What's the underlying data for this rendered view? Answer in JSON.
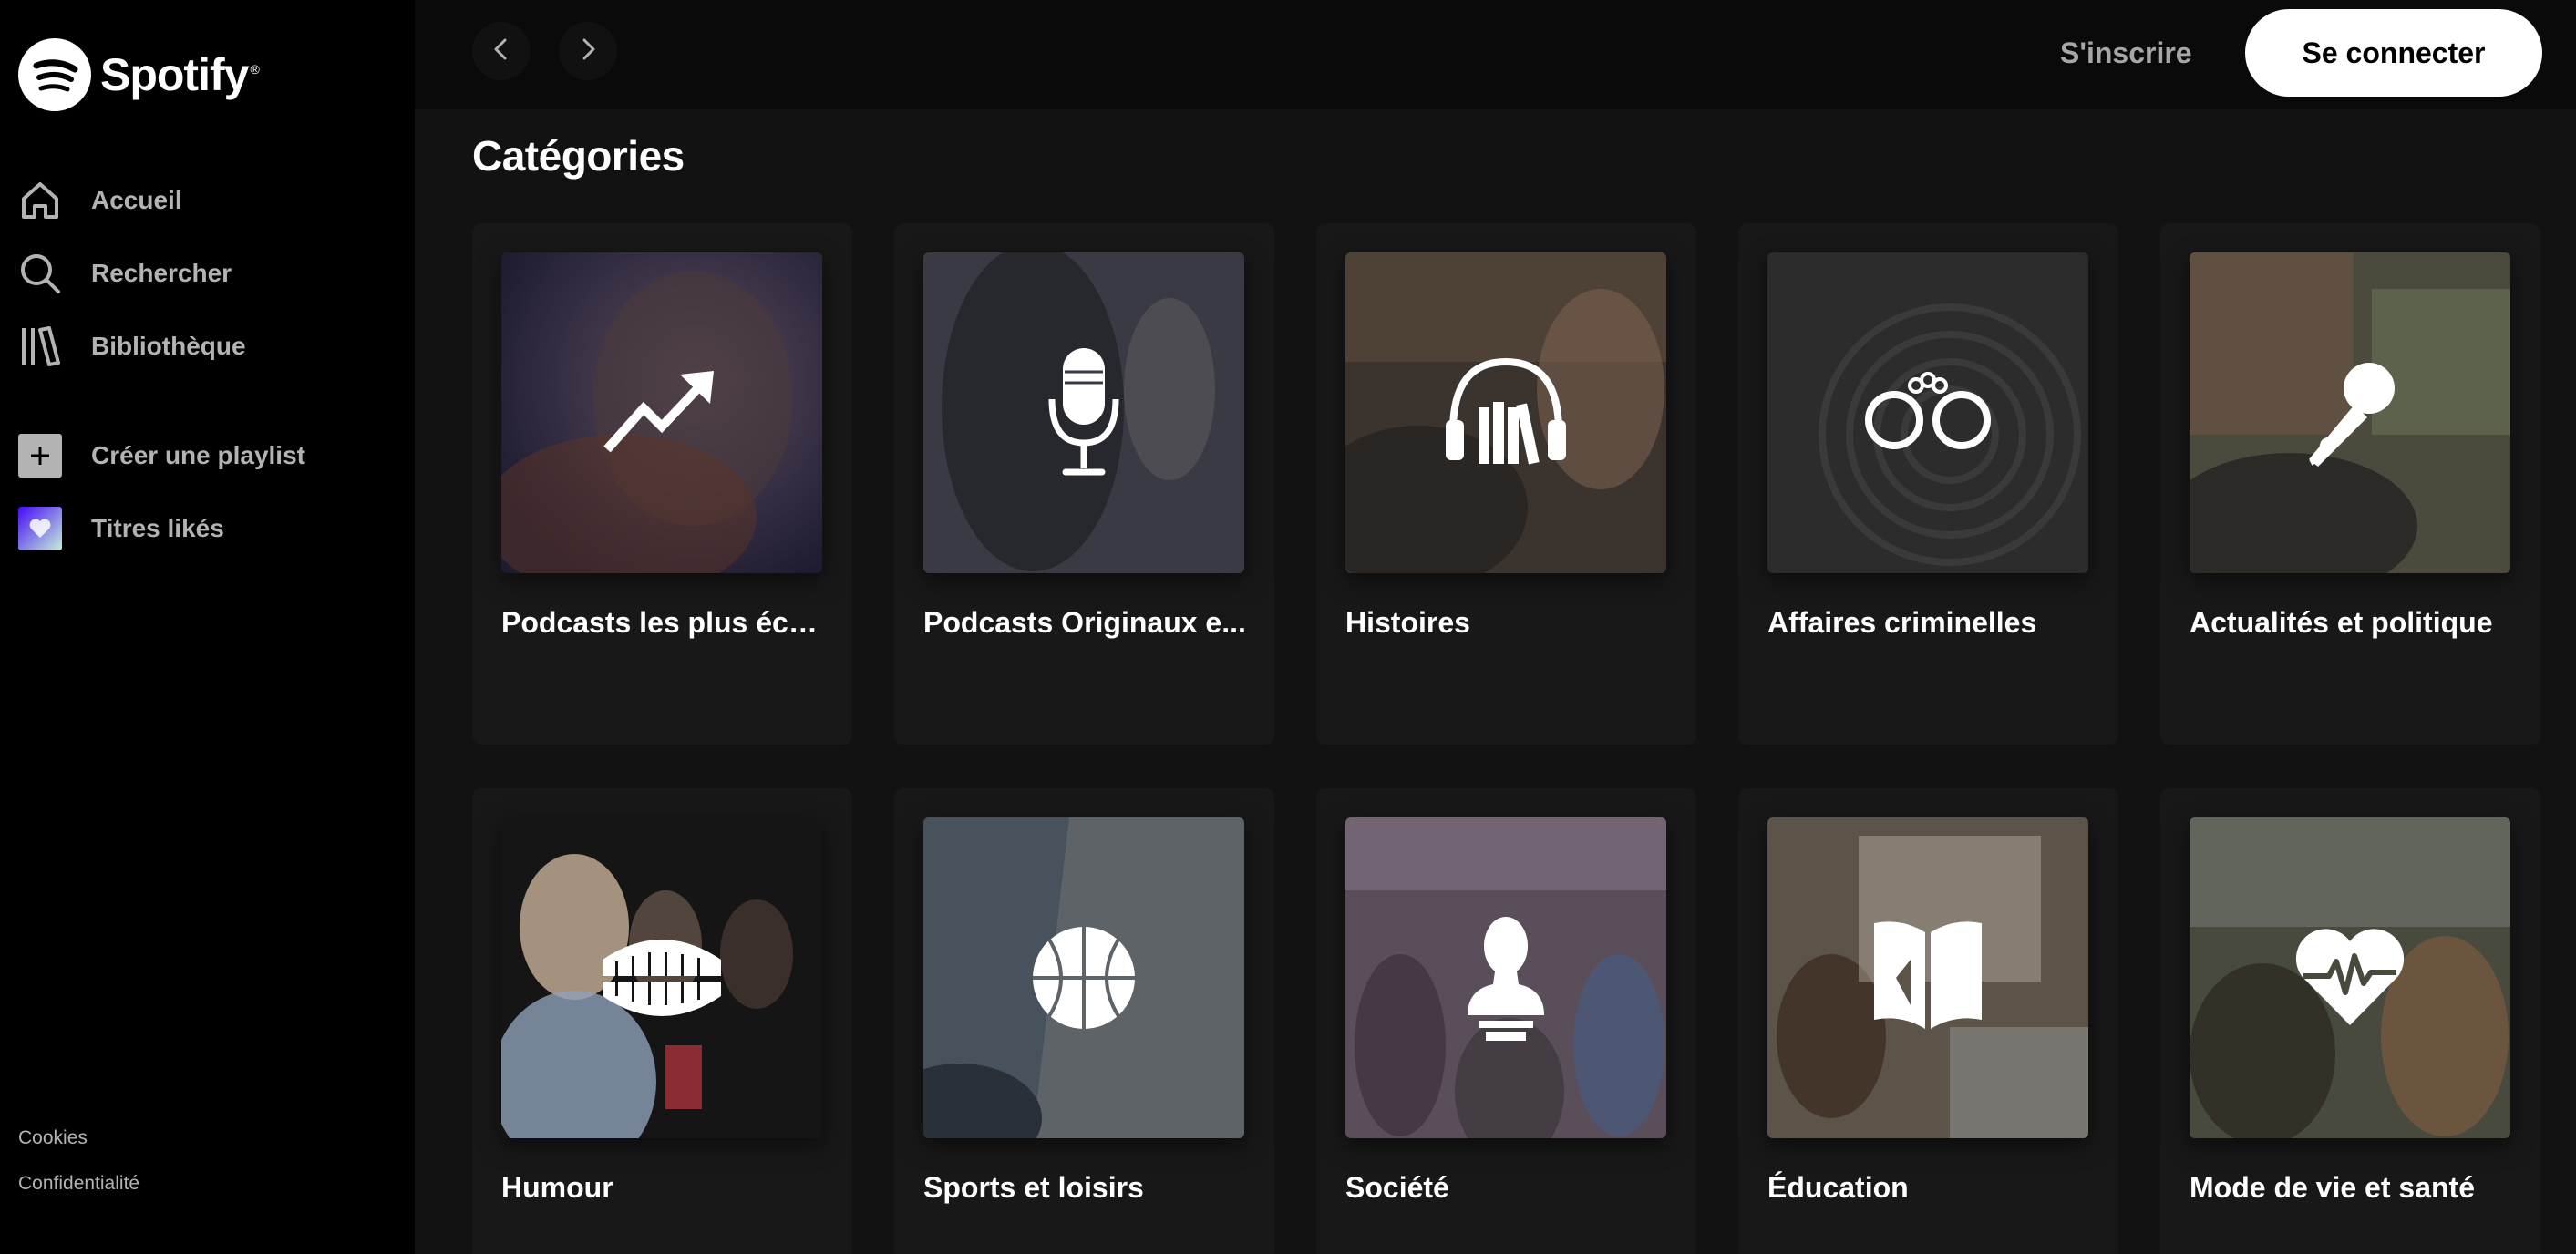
{
  "app": {
    "name": "Spotify"
  },
  "sidebar": {
    "nav": [
      {
        "label": "Accueil",
        "icon": "home-icon"
      },
      {
        "label": "Rechercher",
        "icon": "search-icon"
      },
      {
        "label": "Bibliothèque",
        "icon": "library-icon"
      }
    ],
    "actions": [
      {
        "label": "Créer une playlist",
        "icon": "plus-icon"
      },
      {
        "label": "Titres likés",
        "icon": "heart-icon"
      }
    ],
    "legal": [
      "Cookies",
      "Confidentialité"
    ]
  },
  "topbar": {
    "back_icon": "chevron-left-icon",
    "forward_icon": "chevron-right-icon",
    "signup_label": "S'inscrire",
    "login_label": "Se connecter"
  },
  "main": {
    "section_title": "Catégories",
    "categories": [
      {
        "title": "Podcasts les plus éco...",
        "icon": "trending-up-icon",
        "bg": "#3a3650"
      },
      {
        "title": "Podcasts Originaux e...",
        "icon": "microphone-icon",
        "bg": "#3b3b45"
      },
      {
        "title": "Histoires",
        "icon": "headphones-books-icon",
        "bg": "#3e3834"
      },
      {
        "title": "Affaires criminelles",
        "icon": "handcuffs-icon",
        "bg": "#2f2f2f"
      },
      {
        "title": "Actualités et politique",
        "icon": "hand-microphone-icon",
        "bg": "#4a4a3c"
      },
      {
        "title": "Humour",
        "icon": "chattering-teeth-icon",
        "bg": "#2a2a2a"
      },
      {
        "title": "Sports et loisirs",
        "icon": "basketball-icon",
        "bg": "#5a5f64"
      },
      {
        "title": "Société",
        "icon": "bust-icon",
        "bg": "#5a4d5a"
      },
      {
        "title": "Éducation",
        "icon": "open-book-icon",
        "bg": "#5c5349"
      },
      {
        "title": "Mode de vie et santé",
        "icon": "heart-pulse-icon",
        "bg": "#4a4a3e"
      }
    ]
  }
}
